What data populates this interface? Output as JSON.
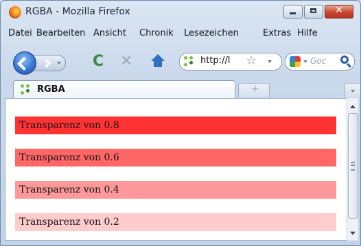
{
  "window": {
    "title": "RGBA - Mozilla Firefox"
  },
  "menu": [
    "Datei",
    "Bearbeiten",
    "Ansicht",
    "Chronik",
    "Lesezeichen",
    "Extras",
    "Hilfe"
  ],
  "navbar": {
    "url": "http://l",
    "search_placeholder": "Goc"
  },
  "tab": {
    "label": "RGBA",
    "new_tab": "+"
  },
  "content": {
    "bars": [
      {
        "text": "Transparenz von 0.8",
        "alpha": 0.8
      },
      {
        "text": "Transparenz von 0.6",
        "alpha": 0.6
      },
      {
        "text": "Transparenz von 0.4",
        "alpha": 0.4
      },
      {
        "text": "Transparenz von 0.2",
        "alpha": 0.2
      }
    ],
    "bar_color": "#ff0000"
  },
  "colors": {
    "accent": "#2f6fc0",
    "close": "#c8482f"
  }
}
